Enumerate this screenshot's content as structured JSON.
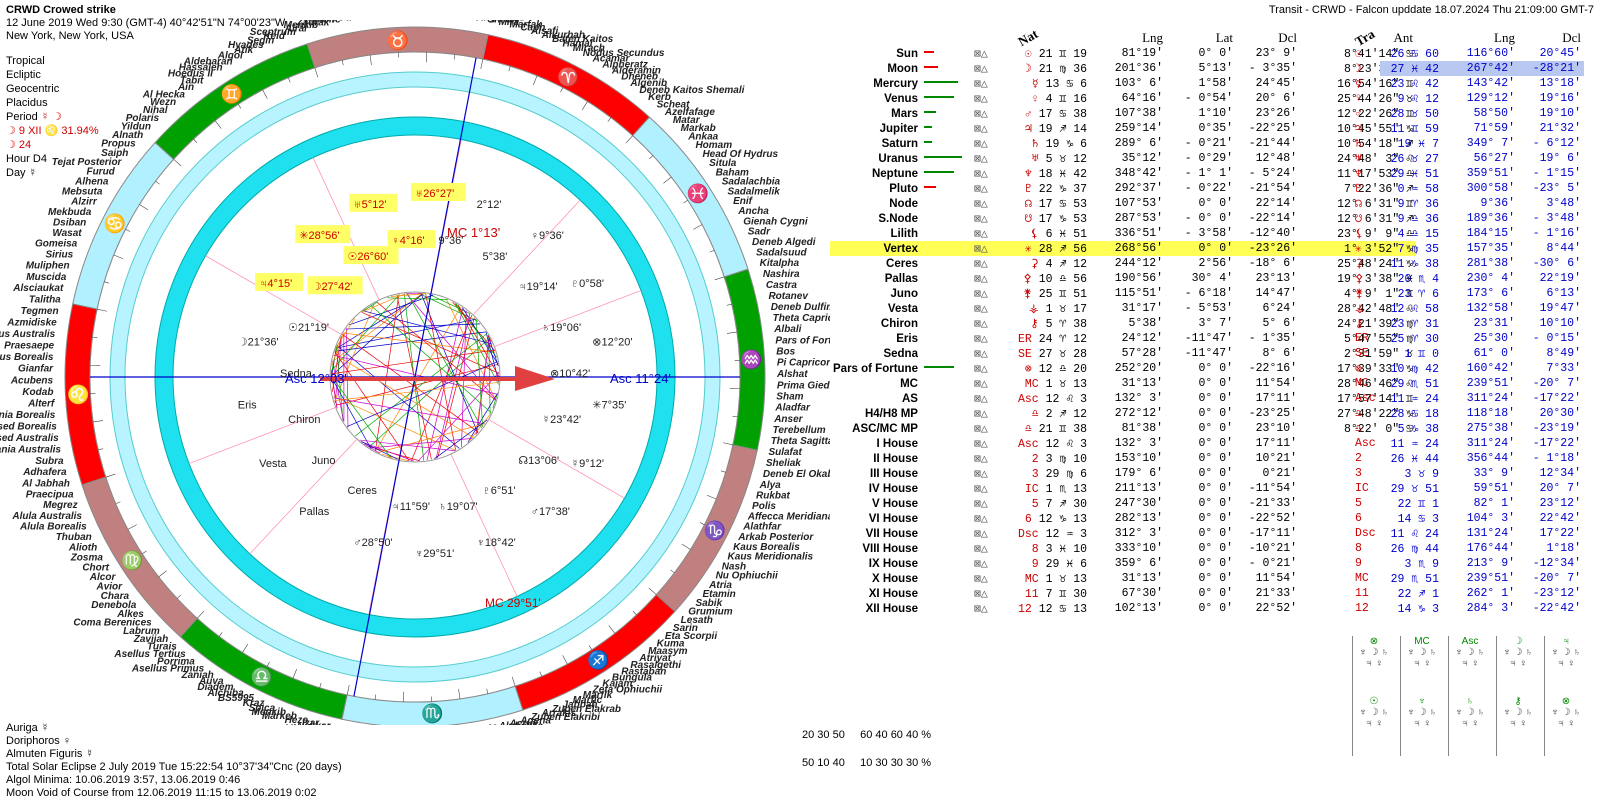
{
  "header": {
    "title": "CRWD Crowed strike",
    "date_line": "12 June 2019  Wed   9:30 (GMT-4) 40°42'51\"N  74°00'23\"W",
    "location": "New York, New York, USA"
  },
  "chart_settings": {
    "zodiac": "Tropical",
    "coordinates": "Ecliptic",
    "centric": "Geocentric",
    "houses": "Placidus",
    "period_label": "Period",
    "period_glyphs": "☿ ☽",
    "moon_phase": "☽  9 XII  ♌ 31.94%",
    "moon_day": "☽  24",
    "hour": "Hour D4",
    "day": "Day ☿"
  },
  "transit_title": "Transit - CRWD - Falcon upddate 18.07.2024   Thu 21:09:00 GMT-7",
  "natal_table": {
    "header": [
      "Nat",
      "Lng",
      "Lat",
      "Dcl",
      "Ant"
    ],
    "rows": [
      {
        "name": "Sun",
        "glyph": "☉",
        "pos": "21 ♊ 19",
        "lng": "81°19'",
        "lat": "0° 0'",
        "dcl": "23° 9'",
        "ant": "8°41'14\" ♋"
      },
      {
        "name": "Moon",
        "glyph": "☽",
        "pos": "21 ♍ 36",
        "lng": "201°36'",
        "lat": "5°13'",
        "dcl": "- 3°35'",
        "ant": "8°23'33\" ♓"
      },
      {
        "name": "Mercury",
        "glyph": "☿",
        "pos": "13 ♋ 6",
        "lng": "103° 6'",
        "lat": "1°58'",
        "dcl": "24°45'",
        "ant": "16°54'16\" ♊"
      },
      {
        "name": "Venus",
        "glyph": "♀",
        "pos": "4 ♊ 16",
        "lng": "64°16'",
        "lat": "- 0°54'",
        "dcl": "20° 6'",
        "ant": "25°44'26\" ♉"
      },
      {
        "name": "Mars",
        "glyph": "♂",
        "pos": "17 ♋ 38",
        "lng": "107°38'",
        "lat": "1°10'",
        "dcl": "23°26'",
        "ant": "12°22'26\" ♊"
      },
      {
        "name": "Jupiter",
        "glyph": "♃",
        "pos": "19 ♐ 14",
        "lng": "259°14'",
        "lat": "0°35'",
        "dcl": "-22°25'",
        "ant": "10°45'55\" ♑"
      },
      {
        "name": "Saturn",
        "glyph": "♄",
        "pos": "19 ♑ 6",
        "lng": "289° 6'",
        "lat": "- 0°21'",
        "dcl": "-21°44'",
        "ant": "10°54'18\" ♐"
      },
      {
        "name": "Uranus",
        "glyph": "♅",
        "pos": "5 ♉ 12",
        "lng": "35°12'",
        "lat": "- 0°29'",
        "dcl": "12°48'",
        "ant": "24°48' 3\" ♌"
      },
      {
        "name": "Neptune",
        "glyph": "♆",
        "pos": "18 ♓ 42",
        "lng": "348°42'",
        "lat": "- 1° 1'",
        "dcl": "- 5°24'",
        "ant": "11°17'53\" ♎"
      },
      {
        "name": "Pluto",
        "glyph": "♇",
        "pos": "22 ♑ 37",
        "lng": "292°37'",
        "lat": "- 0°22'",
        "dcl": "-21°54'",
        "ant": "7°22'36\" ♐"
      },
      {
        "name": "Node",
        "glyph": "☊",
        "pos": "17 ♋ 53",
        "lng": "107°53'",
        "lat": "0° 0'",
        "dcl": "22°14'",
        "ant": "12° 6'31\" ♊"
      },
      {
        "name": "S.Node",
        "glyph": "☋",
        "pos": "17 ♑ 53",
        "lng": "287°53'",
        "lat": "- 0° 0'",
        "dcl": "-22°14'",
        "ant": "12° 6'31\" ♐"
      },
      {
        "name": "Lilith",
        "glyph": "⚸",
        "pos": "6 ♓ 51",
        "lng": "336°51'",
        "lat": "- 3°58'",
        "dcl": "-12°40'",
        "ant": "23° 9' 9\" ♎"
      },
      {
        "name": "Vertex",
        "glyph": "✳",
        "pos": "28 ♐ 56",
        "lng": "268°56'",
        "lat": "0° 0'",
        "dcl": "-23°26'",
        "ant": "1° 3'52\" ♑"
      },
      {
        "name": "Ceres",
        "glyph": "⚳",
        "pos": "4 ♐ 12",
        "lng": "244°12'",
        "lat": "2°56'",
        "dcl": "-18° 6'",
        "ant": "25°48'24\" ♑"
      },
      {
        "name": "Pallas",
        "glyph": "⚴",
        "pos": "10 ♎ 56",
        "lng": "190°56'",
        "lat": "30° 4'",
        "dcl": "23°13'",
        "ant": "19° 3'38\" ♓"
      },
      {
        "name": "Juno",
        "glyph": "⚵",
        "pos": "25 ♊ 51",
        "lng": "115°51'",
        "lat": "- 6°18'",
        "dcl": "14°47'",
        "ant": "4° 9' 1\" ♊"
      },
      {
        "name": "Vesta",
        "glyph": "⚶",
        "pos": "1 ♉ 17",
        "lng": "31°17'",
        "lat": "- 5°53'",
        "dcl": "6°24'",
        "ant": "28°42'48\" ♌"
      },
      {
        "name": "Chiron",
        "glyph": "⚷",
        "pos": "5 ♈ 38",
        "lng": "5°38'",
        "lat": "3° 7'",
        "dcl": "5° 6'",
        "ant": "24°21'39\" ♍"
      },
      {
        "name": "Eris",
        "glyph": "ER",
        "pos": "24 ♈ 12",
        "lng": "24°12'",
        "lat": "-11°47'",
        "dcl": "- 1°35'",
        "ant": "5°47'55\" ♍"
      },
      {
        "name": "Sedna",
        "glyph": "SE",
        "pos": "27 ♉ 28",
        "lng": "57°28'",
        "lat": "-11°47'",
        "dcl": "8° 6'",
        "ant": "2°31'59\" ♉"
      },
      {
        "name": "Pars of Fortune",
        "glyph": "⊗",
        "pos": "12 ♎ 20",
        "lng": "252°20'",
        "lat": "0° 0'",
        "dcl": "-22°16'",
        "ant": "17°39'33\" ♑"
      },
      {
        "name": "MC",
        "glyph": "MC",
        "pos": "1 ♉ 13",
        "lng": "31°13'",
        "lat": "0° 0'",
        "dcl": "11°54'",
        "ant": "28°46'46\" ♌"
      },
      {
        "name": "AS",
        "glyph": "Asc",
        "pos": "12 ♌ 3",
        "lng": "132° 3'",
        "lat": "0° 0'",
        "dcl": "17°11'",
        "ant": "17°57'14\" ♊"
      },
      {
        "name": "H4/H8 MP",
        "glyph": "♎",
        "pos": "2 ♐ 12",
        "lng": "272°12'",
        "lat": "0° 0'",
        "dcl": "-23°25'",
        "ant": "27°48'22\" ♑"
      },
      {
        "name": "ASC/MC MP",
        "glyph": "♎",
        "pos": "21 ♊ 38",
        "lng": "81°38'",
        "lat": "0° 0'",
        "dcl": "23°10'",
        "ant": "8°22' 0\" ♋"
      },
      {
        "name": "I House",
        "glyph": "Asc",
        "pos": "12 ♌ 3",
        "lng": "132° 3'",
        "lat": "0° 0'",
        "dcl": "17°11'",
        "ant": ""
      },
      {
        "name": "II House",
        "glyph": "2",
        "pos": "3 ♍ 10",
        "lng": "153°10'",
        "lat": "0° 0'",
        "dcl": "10°21'",
        "ant": ""
      },
      {
        "name": "III House",
        "glyph": "3",
        "pos": "29 ♍ 6",
        "lng": "179° 6'",
        "lat": "0° 0'",
        "dcl": "0°21'",
        "ant": ""
      },
      {
        "name": "IV House",
        "glyph": "IC",
        "pos": "1 ♏ 13",
        "lng": "211°13'",
        "lat": "0° 0'",
        "dcl": "-11°54'",
        "ant": ""
      },
      {
        "name": "V House",
        "glyph": "5",
        "pos": "7 ♐ 30",
        "lng": "247°30'",
        "lat": "0° 0'",
        "dcl": "-21°33'",
        "ant": ""
      },
      {
        "name": "VI House",
        "glyph": "6",
        "pos": "12 ♑ 13",
        "lng": "282°13'",
        "lat": "0° 0'",
        "dcl": "-22°52'",
        "ant": ""
      },
      {
        "name": "VII House",
        "glyph": "Dsc",
        "pos": "12 ♒ 3",
        "lng": "312° 3'",
        "lat": "0° 0'",
        "dcl": "-17°11'",
        "ant": ""
      },
      {
        "name": "VIII House",
        "glyph": "8",
        "pos": "3 ♓ 10",
        "lng": "333°10'",
        "lat": "0° 0'",
        "dcl": "-10°21'",
        "ant": ""
      },
      {
        "name": "IX House",
        "glyph": "9",
        "pos": "29 ♓ 6",
        "lng": "359° 6'",
        "lat": "0° 0'",
        "dcl": "- 0°21'",
        "ant": ""
      },
      {
        "name": "X House",
        "glyph": "MC",
        "pos": "1 ♉ 13",
        "lng": "31°13'",
        "lat": "0° 0'",
        "dcl": "11°54'",
        "ant": ""
      },
      {
        "name": "XI House",
        "glyph": "11",
        "pos": "7 ♊ 30",
        "lng": "67°30'",
        "lat": "0° 0'",
        "dcl": "21°33'",
        "ant": ""
      },
      {
        "name": "XII House",
        "glyph": "12",
        "pos": "12 ♋ 13",
        "lng": "102°13'",
        "lat": "0° 0'",
        "dcl": "22°52'",
        "ant": ""
      }
    ]
  },
  "transit_table": {
    "header": [
      "Tra",
      "Lng",
      "Dcl"
    ],
    "rows": [
      {
        "pos": "26 ♋ 60",
        "lng": "116°60'",
        "dcl": "20°45'"
      },
      {
        "pos": "27 ♓ 42",
        "lng": "267°42'",
        "dcl": "-28°21'"
      },
      {
        "pos": "23 ♌ 42",
        "lng": "143°42'",
        "dcl": "13°18'"
      },
      {
        "pos": "9 ♌ 12",
        "lng": "129°12'",
        "dcl": "19°16'"
      },
      {
        "pos": "28 ♉ 50",
        "lng": "58°50'",
        "dcl": "19°10'"
      },
      {
        "pos": "11 ♊ 59",
        "lng": "71°59'",
        "dcl": "21°32'"
      },
      {
        "pos": "19 ♓ 7",
        "lng": "349° 7'",
        "dcl": "- 6°12'"
      },
      {
        "pos": "26 ♉ 27",
        "lng": "56°27'",
        "dcl": "19° 6'"
      },
      {
        "pos": "29 ♓ 51",
        "lng": "359°51'",
        "dcl": "- 1°15'"
      },
      {
        "pos": "0 ♒ 58",
        "lng": "300°58'",
        "dcl": "-23° 5'"
      },
      {
        "pos": "9 ♈ 36",
        "lng": "9°36'",
        "dcl": "3°48'"
      },
      {
        "pos": "9 ♎ 36",
        "lng": "189°36'",
        "dcl": "- 3°48'"
      },
      {
        "pos": "4 ♎ 15",
        "lng": "184°15'",
        "dcl": "- 1°16'"
      },
      {
        "pos": "7 ♍ 35",
        "lng": "157°35'",
        "dcl": "8°44'"
      },
      {
        "pos": "11 ♑ 38",
        "lng": "281°38'",
        "dcl": "-30° 6'"
      },
      {
        "pos": "20 ♏ 4",
        "lng": "230° 4'",
        "dcl": "22°19'"
      },
      {
        "pos": "23 ♈ 6",
        "lng": "173° 6'",
        "dcl": "6°13'"
      },
      {
        "pos": "12 ♌ 58",
        "lng": "132°58'",
        "dcl": "19°47'"
      },
      {
        "pos": "23 ♈ 31",
        "lng": "23°31'",
        "dcl": "10°10'"
      },
      {
        "pos": "25 ♈ 30",
        "lng": "25°30'",
        "dcl": "- 0°15'"
      },
      {
        "pos": "1 ♊ 0",
        "lng": "61° 0'",
        "dcl": "8°49'"
      },
      {
        "pos": "10 ♍ 42",
        "lng": "160°42'",
        "dcl": "7°33'"
      },
      {
        "pos": "29 ♏ 51",
        "lng": "239°51'",
        "dcl": "-20° 7'"
      },
      {
        "pos": "11 ♒ 24",
        "lng": "311°24'",
        "dcl": "-17°22'"
      },
      {
        "pos": "28 ♋ 18",
        "lng": "118°18'",
        "dcl": "20°30'"
      },
      {
        "pos": "5 ♑ 38",
        "lng": "275°38'",
        "dcl": "-23°19'"
      },
      {
        "pos": "11 ♒ 24",
        "lng": "311°24'",
        "dcl": "-17°22'"
      },
      {
        "pos": "26 ♓ 44",
        "lng": "356°44'",
        "dcl": "- 1°18'"
      },
      {
        "pos": "3 ♉ 9",
        "lng": "33° 9'",
        "dcl": "12°34'"
      },
      {
        "pos": "29 ♉ 51",
        "lng": "59°51'",
        "dcl": "20° 7'"
      },
      {
        "pos": "22 ♊ 1",
        "lng": "82° 1'",
        "dcl": "23°12'"
      },
      {
        "pos": "14 ♋ 3",
        "lng": "104° 3'",
        "dcl": "22°42'"
      },
      {
        "pos": "11 ♌ 24",
        "lng": "131°24'",
        "dcl": "17°22'"
      },
      {
        "pos": "26 ♍ 44",
        "lng": "176°44'",
        "dcl": "1°18'"
      },
      {
        "pos": "3 ♏ 9",
        "lng": "213° 9'",
        "dcl": "-12°34'"
      },
      {
        "pos": "29 ♏ 51",
        "lng": "239°51'",
        "dcl": "-20° 7'"
      },
      {
        "pos": "22 ♐ 1",
        "lng": "262° 1'",
        "dcl": "-23°12'"
      },
      {
        "pos": "14 ♑ 3",
        "lng": "284° 3'",
        "dcl": "-22°42'"
      }
    ]
  },
  "wheel": {
    "signs": [
      "♈",
      "♉",
      "♊",
      "♋",
      "♌",
      "♍",
      "♎",
      "♏",
      "♐",
      "♑",
      "♒",
      "♓"
    ],
    "sign_colors": [
      "#ff0000",
      "#c08080",
      "#00a000",
      "#b0f0ff",
      "#ff0000",
      "#c08080",
      "#00a000",
      "#b0f0ff",
      "#ff0000",
      "#c08080",
      "#00a000",
      "#b0f0ff"
    ],
    "asc_label": "Asc",
    "asc_natal": "12°03'",
    "asc_transit": "11°24'",
    "mc_label": "MC",
    "mc_natal": "1°13'",
    "mc_transit": "29°51'",
    "planet_labels": [
      {
        "t": "♅26°27'",
        "hl": true
      },
      {
        "t": "♀4°16'",
        "hl": true
      },
      {
        "t": "♅5°12'",
        "hl": true
      },
      {
        "t": "☉26°60'",
        "hl": true
      },
      {
        "t": "✳28°56'",
        "hl": true
      },
      {
        "t": "☽27°42'",
        "hl": true
      },
      {
        "t": "♃4°15'",
        "hl": true
      },
      {
        "t": "☉21°19'",
        "hl": false
      },
      {
        "t": "☽21°36'",
        "hl": false
      },
      {
        "t": "Sedna",
        "hl": false
      },
      {
        "t": "Eris",
        "hl": false
      },
      {
        "t": "Chiron",
        "hl": false
      },
      {
        "t": "Vesta",
        "hl": false
      },
      {
        "t": "Juno",
        "hl": false
      },
      {
        "t": "Pallas",
        "hl": false
      },
      {
        "t": "Ceres",
        "hl": false
      },
      {
        "t": "♂28°50'",
        "hl": false
      },
      {
        "t": "♃11°59'",
        "hl": false
      },
      {
        "t": "♆29°51'",
        "hl": false
      },
      {
        "t": "♄19°07'",
        "hl": false
      },
      {
        "t": "♆18°42'",
        "hl": false
      },
      {
        "t": "♇6°51'",
        "hl": false
      },
      {
        "t": "♂17°38'",
        "hl": false
      },
      {
        "t": "☊13°06'",
        "hl": false
      },
      {
        "t": "☿9°12'",
        "hl": false
      },
      {
        "t": "☿23°42'",
        "hl": false
      },
      {
        "t": "✳7°35'",
        "hl": false
      },
      {
        "t": "⊗10°42'",
        "hl": false
      },
      {
        "t": "⊗12°20'",
        "hl": false
      },
      {
        "t": "♄19°06'",
        "hl": false
      },
      {
        "t": "♇0°58'",
        "hl": false
      },
      {
        "t": "♃19°14'",
        "hl": false
      },
      {
        "t": "♀9°36'",
        "hl": false
      },
      {
        "t": "5°38'",
        "hl": false
      },
      {
        "t": "2°12'",
        "hl": false
      },
      {
        "t": "9°36'",
        "hl": false
      }
    ],
    "stars_left": [
      "Sterope II",
      "Pleione",
      "Zaurak",
      "Menkib",
      "Alrai",
      "Sceptrum",
      "Keid",
      "Segin",
      "Hyades",
      "Atik",
      "Algol",
      "Aldebaran",
      "Hassaleh",
      "Hoedus II",
      "Tabit",
      "Ain",
      "Al Hecka",
      "Wezn",
      "Nihal",
      "Polaris",
      "Yildun",
      "Alnath",
      "Propus",
      "Saiph",
      "Tejat Posterior",
      "Furud",
      "Alhena",
      "Mebsuta",
      "Alzirr",
      "Mekbuda",
      "Dsiban",
      "Wasat",
      "Gomeisa",
      "Sirius",
      "Muliphen",
      "Muscida",
      "Alsciaukat",
      "Talitha",
      "Tegmen",
      "Azmidiske",
      "Asellus Australis",
      "Praesaepe",
      "Asellus Borealis",
      "Gianfar",
      "Acubens",
      "Kodab",
      "Alterf",
      "Tania Borealis",
      "Ras Elased Borealis",
      "Ras Elased Australis",
      "Tania Australis",
      "Subra",
      "Adhafera",
      "Al Jabhah",
      "Praecipua",
      "Megrez",
      "Alula Australis",
      "Alula Borealis",
      "Thuban",
      "Alioth",
      "Zosma",
      "Chort",
      "Alcor",
      "Avior",
      "Chara",
      "Denebola",
      "Alkes",
      "Coma Berenices",
      "Labrum",
      "Zavijah",
      "Turais",
      "Asellus Tertius",
      "Porrima",
      "Asellus Primus",
      "Zaniah",
      "Auva",
      "Diadem",
      "Alchiba",
      "BS5995",
      "Kraz",
      "Spica",
      "Menkib",
      "Markeb",
      "Heze",
      "Izar",
      "Nekkar",
      "Miaplacidus",
      "Alkalurops",
      "Khambalia"
    ],
    "stars_right": [
      "Adhil",
      "Angetenar",
      "Shedir",
      "Mira",
      "Marfak",
      "Caph",
      "Alsafi",
      "Alkurhah",
      "Baten Kaitos",
      "Hamal",
      "Mirach",
      "Nodus Secundus",
      "Acamar",
      "Alpheratz",
      "Alderamin",
      "Dheneb",
      "Algenib",
      "Deneb Kaitos Shemali",
      "Kerb",
      "Scheat",
      "Azelfafage",
      "Matar",
      "Markab",
      "Ankaa",
      "Homam",
      "Head Of Hydrus",
      "Situla",
      "Baham",
      "Sadalachbia",
      "Sadalmelik",
      "Enif",
      "Ancha",
      "Gienah Cygni",
      "Sadr",
      "Deneb Algedi",
      "Sadalsuud",
      "Kitalpha",
      "Nashira",
      "Castra",
      "Rotanev",
      "Deneb Dulfim",
      "Theta Capricorni",
      "Albali",
      "Pars of Fortune",
      "Bos",
      "Pi Capricorni",
      "Alshat",
      "Prima Giedi",
      "Sham",
      "Aladfar",
      "Anser",
      "Terebellum",
      "Theta Sagittarii",
      "Sulafat",
      "Sheliak",
      "Deneb El Okab",
      "Alya",
      "Rukbat",
      "Polis",
      "Affecca Meridiana",
      "Alathfar",
      "Arkab Posterior",
      "Kaus Borealis",
      "Kaus Meridionalis",
      "Nash",
      "Nu Ophiuchii",
      "Atria",
      "Etamin",
      "Sabik",
      "Grumium",
      "Lesath",
      "Sarin",
      "Eta Scorpii",
      "Kuma",
      "Maasym",
      "Atriyat",
      "Rasalgethi",
      "Rastaban",
      "Bungula",
      "Kajam",
      "Zeta Ophiuchii",
      "Marfik",
      "Marfic",
      "Jabbah",
      "Zuben Elakrab",
      "Arrakis",
      "Zuben Elakribi",
      "Agena",
      "Acrux",
      "Alphekka",
      "Menkent",
      "Gacrux",
      "Decrux"
    ]
  },
  "footer": {
    "auriga": "Auriga  ☿",
    "doriphoros": "Doriphoros  ♀",
    "almuten": "Almuten Figuris  ☿",
    "eclipse": "Total Solar Eclipse 2 July 2019 Tue 15:22:54 10°37'34\"Cnc (20 days)",
    "algol": "Algol Minima: 10.06.2019  3:57,  13.06.2019  0:46",
    "moon_void": "Moon Void of Course from 12.06.2019 11:15 to 13.06.2019  0:02"
  },
  "aspect_stats": {
    "row1_left": "20 30 50",
    "row1_right": "60 40 60 40 %",
    "row2_left": "50 10 40",
    "row2_right": "10 30 30 30 %"
  },
  "mini_glyphs": [
    "⊗",
    "MC",
    "Asc",
    "☽",
    "♃",
    "☉",
    "♆",
    "♄",
    "⚷",
    "⊗"
  ]
}
